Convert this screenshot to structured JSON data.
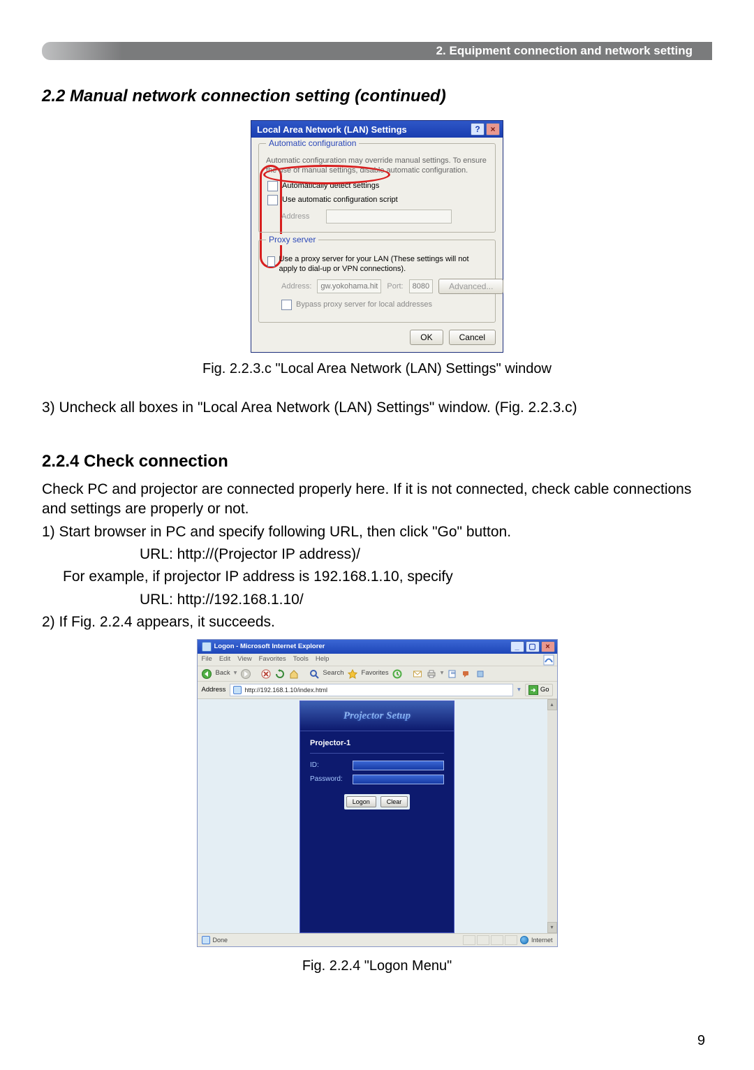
{
  "header": {
    "title": "2. Equipment connection and network setting"
  },
  "section": {
    "title": "2.2 Manual network connection setting (continued)"
  },
  "fig223c": {
    "caption": "Fig. 2.2.3.c \"Local Area Network (LAN) Settings\" window",
    "dialog_title": "Local Area Network (LAN) Settings",
    "auto_group": "Automatic configuration",
    "auto_note": "Automatic configuration may override manual settings. To ensure the use of manual settings, disable automatic configuration.",
    "auto_detect": "Automatically detect settings",
    "use_script": "Use automatic configuration script",
    "address_lbl": "Address",
    "proxy_group": "Proxy server",
    "use_proxy": "Use a proxy server for your LAN (These settings will not apply to dial-up or VPN connections).",
    "addr_lbl2": "Address:",
    "addr_val": "gw.yokohama.hit",
    "port_lbl": "Port:",
    "port_val": "8080",
    "advanced": "Advanced...",
    "bypass": "Bypass proxy server for local addresses",
    "ok": "OK",
    "cancel": "Cancel"
  },
  "step3": "3) Uncheck all boxes in \"Local Area Network (LAN) Settings\" window. (Fig. 2.2.3.c)",
  "s224": {
    "heading": "2.2.4 Check connection",
    "p1": "Check PC and projector are connected properly here. If it is not connected, check cable connections and settings are properly or not.",
    "p2": "1) Start browser in PC and specify following URL, then click \"Go\" button.",
    "url1": "URL: http://(Projector IP address)/",
    "example_line": "For example, if projector IP address is 192.168.1.10, specify",
    "url2": "URL: http://192.168.1.10/",
    "p3": "2) If Fig. 2.2.4 appears, it succeeds.",
    "caption": "Fig. 2.2.4 \"Logon Menu\""
  },
  "ie": {
    "title": "Logon - Microsoft Internet Explorer",
    "menu": {
      "file": "File",
      "edit": "Edit",
      "view": "View",
      "favorites": "Favorites",
      "tools": "Tools",
      "help": "Help"
    },
    "toolbar": {
      "back": "Back",
      "search": "Search",
      "favorites": "Favorites"
    },
    "address_label": "Address",
    "address_value": "http://192.168.1.10/index.html",
    "go": "Go",
    "setup_title": "Projector Setup",
    "projector_name": "Projector-1",
    "id_label": "ID:",
    "pw_label": "Password:",
    "logon_btn": "Logon",
    "clear_btn": "Clear",
    "status_done": "Done",
    "status_zone": "Internet"
  },
  "page_number": "9"
}
